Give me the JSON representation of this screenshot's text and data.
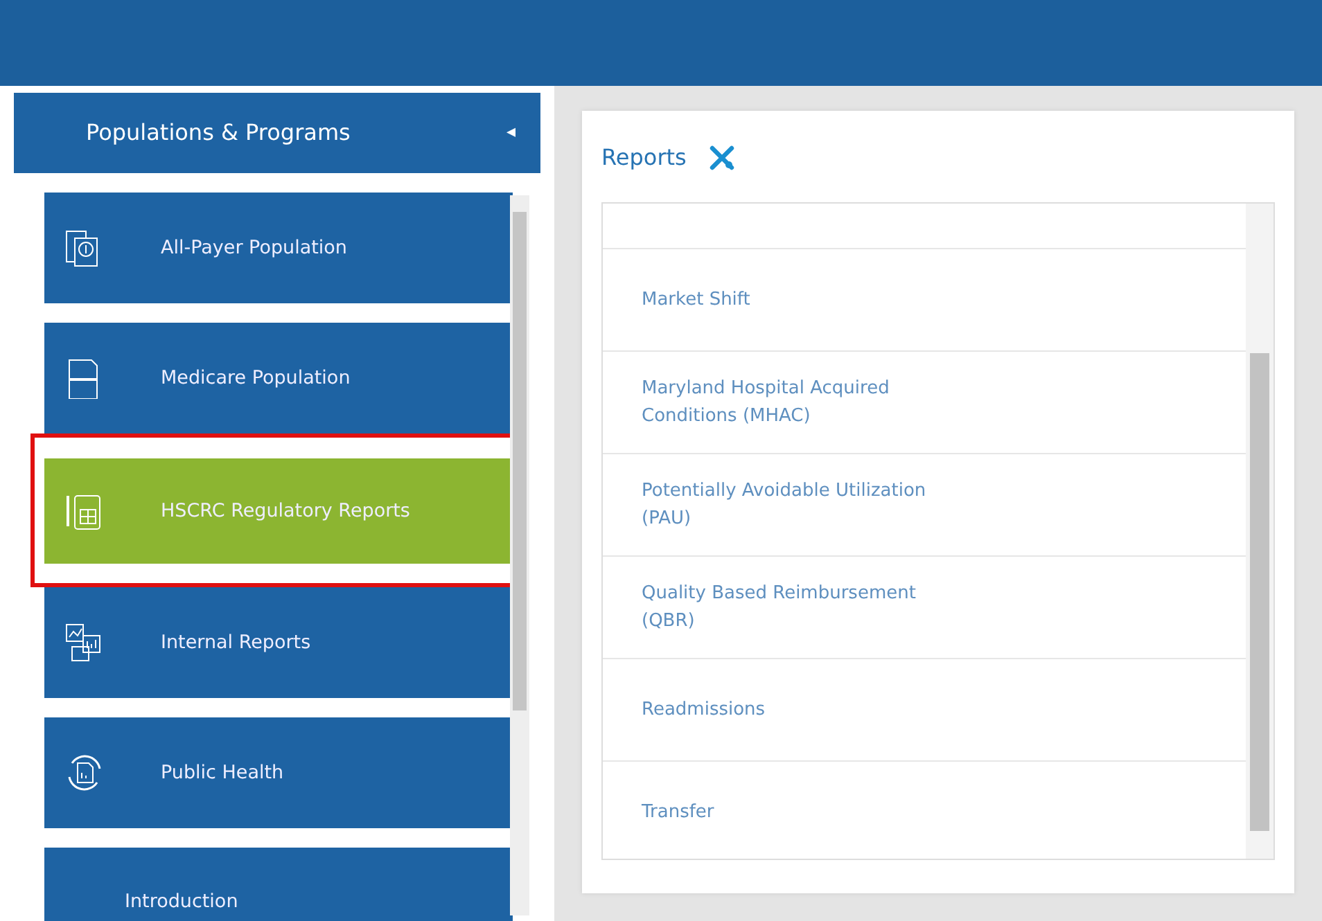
{
  "sidebar": {
    "title": "Populations & Programs",
    "collapse_glyph": "◂",
    "items": [
      {
        "label": "All-Payer Population",
        "selected": false,
        "highlighted": false
      },
      {
        "label": "Medicare Population",
        "selected": false,
        "highlighted": false
      },
      {
        "label": "HSCRC Regulatory Reports",
        "selected": true,
        "highlighted": true
      },
      {
        "label": "Internal Reports",
        "selected": false,
        "highlighted": false
      },
      {
        "label": "Public Health",
        "selected": false,
        "highlighted": false
      },
      {
        "label": "Introduction",
        "selected": false,
        "highlighted": false
      }
    ]
  },
  "reports": {
    "title": "Reports",
    "items": [
      {
        "label": "Market Shift"
      },
      {
        "label": "Maryland Hospital Acquired\nConditions (MHAC)"
      },
      {
        "label": "Potentially Avoidable Utilization\n(PAU)"
      },
      {
        "label": "Quality Based Reimbursement\n(QBR)"
      },
      {
        "label": "Readmissions"
      },
      {
        "label": "Transfer"
      }
    ]
  }
}
